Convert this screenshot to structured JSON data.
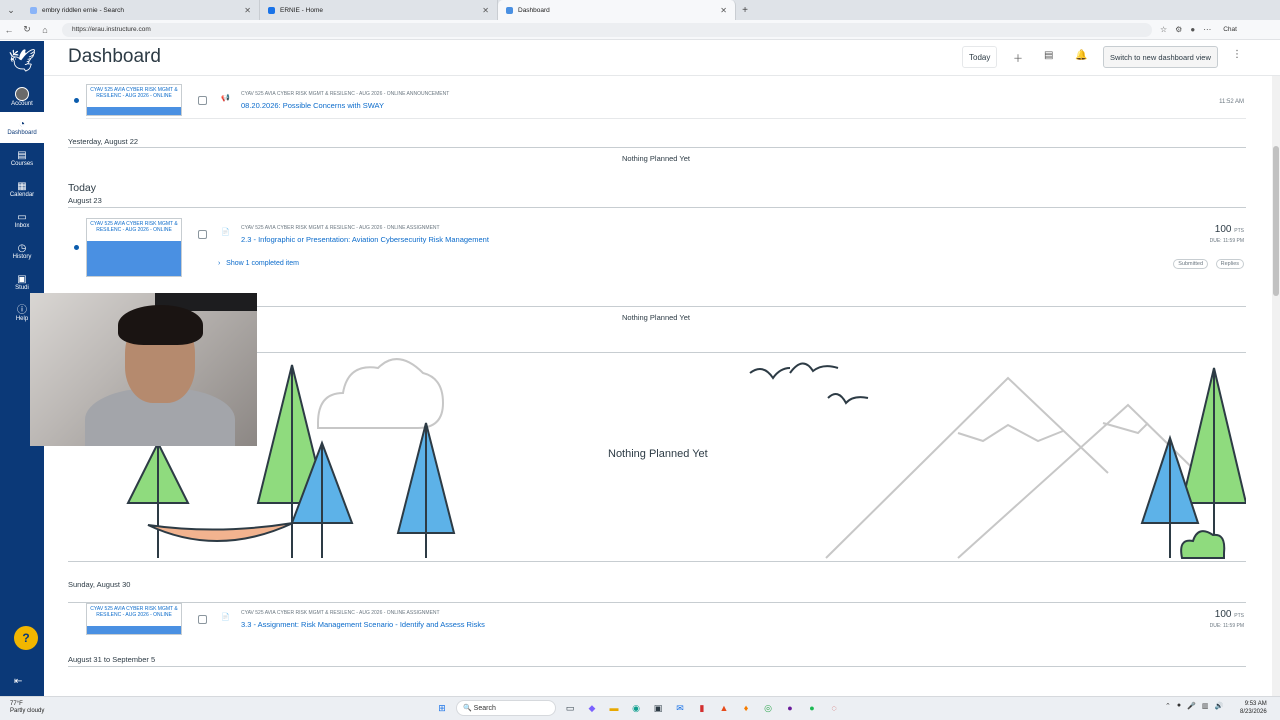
{
  "browser": {
    "tabs": [
      {
        "label": "embry riddlen ernie - Search",
        "color": "#8ab4f8"
      },
      {
        "label": "ERNIE - Home",
        "color": "#1a73e8"
      },
      {
        "label": "Dashboard",
        "color": "#4a90e2"
      }
    ],
    "url": "https://erau.instructure.com",
    "chat_label": "Chat"
  },
  "leftnav": {
    "items": [
      {
        "label": "Account",
        "icon": "account-icon"
      },
      {
        "label": "Dashboard",
        "icon": "dashboard-icon"
      },
      {
        "label": "Courses",
        "icon": "courses-icon"
      },
      {
        "label": "Calendar",
        "icon": "calendar-icon"
      },
      {
        "label": "Inbox",
        "icon": "inbox-icon"
      },
      {
        "label": "History",
        "icon": "history-icon"
      },
      {
        "label": "Studi",
        "icon": "studio-icon"
      },
      {
        "label": "Help",
        "icon": "help-icon"
      }
    ]
  },
  "header": {
    "title": "Dashboard",
    "today_label": "Today",
    "switch_label": "Switch to new dashboard view"
  },
  "planner": {
    "course_card_text": "CYAV 525 AVIA CYBER RISK MGMT & RESILENC - AUG 2026 - ONLINE",
    "items": [
      {
        "course": "CYAV 525 AVIA CYBER RISK MGMT & RESILENC - AUG 2026 - ONLINE ANNOUNCEMENT",
        "title": "08.20.2026: Possible Concerns with SWAY",
        "time": "11:52 AM"
      },
      {
        "course": "CYAV 525 AVIA CYBER RISK MGMT & RESILENC - AUG 2026 - ONLINE ASSIGNMENT",
        "title": "2.3 - Infographic or Presentation: Aviation Cybersecurity Risk Management",
        "points": "100",
        "pts_label": "PTS",
        "due": "DUE: 11:59 PM",
        "completed_link": "Show 1 completed item",
        "pill1": "Submitted",
        "pill2": "Replies"
      },
      {
        "course": "CYAV 525 AVIA CYBER RISK MGMT & RESILENC - AUG 2026 - ONLINE ASSIGNMENT",
        "title": "3.3 - Assignment: Risk Management Scenario - Identify and Assess Risks",
        "points": "100",
        "pts_label": "PTS",
        "due": "DUE: 11:59 PM"
      }
    ],
    "days": {
      "yesterday": "Yesterday, August 22",
      "today": "Today",
      "today_date": "August 23",
      "sunday": "Sunday, August 30",
      "range": "August 31 to September 5"
    },
    "nothing": "Nothing Planned Yet"
  },
  "taskbar": {
    "temp": "77°F",
    "weather": "Partly cloudy",
    "search": "Search",
    "time": "9:53 AM",
    "date": "8/23/2026"
  },
  "colors": {
    "nav_bg": "#0b3978",
    "link": "#0b6bcb",
    "card_band": "#4a90e2",
    "tree_green": "#8fdb7e",
    "tree_blue": "#5db2e8",
    "hammock": "#f2b38f"
  }
}
